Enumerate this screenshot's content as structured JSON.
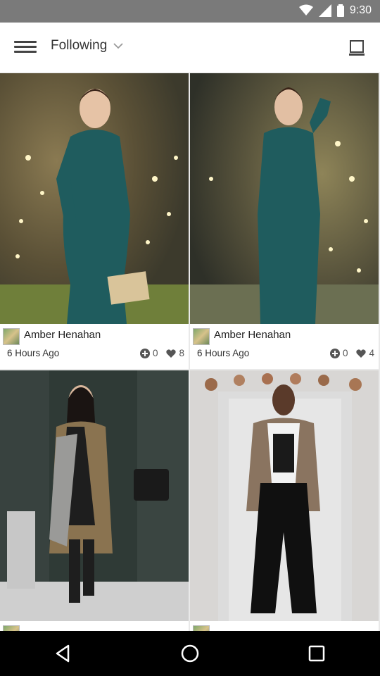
{
  "status_bar": {
    "time": "9:30",
    "icons": [
      "wifi-icon",
      "signal-icon",
      "battery-icon"
    ]
  },
  "app_bar": {
    "title": "Following",
    "menu_icon": "hamburger-menu-icon",
    "dropdown_icon": "chevron-down-icon",
    "view_icon": "layout-toggle-icon"
  },
  "posts": [
    {
      "author": "Amber Henahan",
      "time_ago": "6 Hours Ago",
      "adds": "0",
      "likes": "8"
    },
    {
      "author": "Amber Henahan",
      "time_ago": "6 Hours Ago",
      "adds": "0",
      "likes": "4"
    },
    {
      "author": "",
      "time_ago": "",
      "adds": "",
      "likes": ""
    },
    {
      "author": "",
      "time_ago": "",
      "adds": "",
      "likes": ""
    }
  ],
  "nav_bar": {
    "buttons": [
      "back-icon",
      "home-icon",
      "recents-icon"
    ]
  },
  "colors": {
    "status_bar": "#7a7a7a",
    "nav_bar": "#000000",
    "accent": "#1f5c5e"
  }
}
